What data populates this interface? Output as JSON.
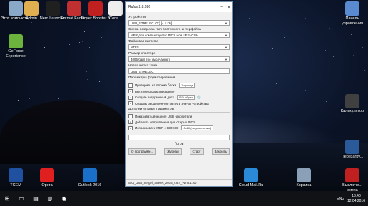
{
  "desktop": {
    "icons": [
      {
        "name": "desktop-icon-computer",
        "label": "Этот компьютер",
        "color": "#8aa9c8"
      },
      {
        "name": "desktop-icon-admin",
        "label": "Admin",
        "color": "#e0b050"
      },
      {
        "name": "desktop-icon-nero",
        "label": "Nero Launcher",
        "color": "#202020"
      },
      {
        "name": "desktop-icon-format-factory",
        "label": "Format Factory",
        "color": "#c03030"
      },
      {
        "name": "desktop-icon-driver-booster",
        "label": "Driver Booster 3",
        "color": "#c02020"
      },
      {
        "name": "desktop-icon-corel",
        "label": "Corel...",
        "color": "#eeeeee"
      },
      {
        "name": "desktop-icon-geforce",
        "label": "GeForce Experience",
        "color": "#6cb33e"
      },
      {
        "name": "desktop-icon-control-panel",
        "label": "Панель управления",
        "color": "#5a8ad0"
      },
      {
        "name": "desktop-icon-calculator",
        "label": "Калькулятор",
        "color": "#404040"
      },
      {
        "name": "desktop-icon-restart",
        "label": "Перезагру...",
        "color": "#2a5a9a"
      },
      {
        "name": "desktop-icon-tcem",
        "label": "TCEM",
        "color": "#2050a0"
      },
      {
        "name": "desktop-icon-opera",
        "label": "Opera",
        "color": "#e02020"
      },
      {
        "name": "desktop-icon-outlook",
        "label": "Outlook 2016",
        "color": "#1a70c8"
      },
      {
        "name": "desktop-icon-skype",
        "label": "Skype",
        "color": "#00a8e8"
      },
      {
        "name": "desktop-icon-cloud-mail",
        "label": "Cloud Mail.Ru",
        "color": "#2a8ad8"
      },
      {
        "name": "desktop-icon-recycle-bin",
        "label": "Корзина",
        "color": "#8aa0b8"
      },
      {
        "name": "desktop-icon-shutdown",
        "label": "Выключе... компа",
        "color": "#c02020"
      }
    ]
  },
  "rufus": {
    "title": "Rufus 2.8.886",
    "device_label": "Устройство",
    "device_value": "USB_STRELEC (G:) [4.1 ГБ]",
    "partition_label": "Схема раздела и тип системного интерфейса",
    "partition_value": "MBR для компьютеров с BIOS или UEFI-CSM",
    "fs_label": "Файловая система",
    "fs_value": "NTFS",
    "cluster_label": "Размер кластера",
    "cluster_value": "4096 байт (по умолчанию)",
    "volume_label": "Новая метка тома",
    "volume_value": "USB_STRELEC",
    "format_options_label": "Параметры форматирования",
    "opt_badblocks": "Проверить на плохие блоки",
    "opt_badblocks_pass": "1 проход",
    "opt_quick": "Быстрое форматирование",
    "opt_bootable": "Создать загрузочный диск",
    "opt_bootable_type": "ISO-образ",
    "opt_extended": "Создать расширенную метку и значок устройства",
    "advanced_label": "Дополнительные параметры",
    "opt_show_usb": "Показывать внешние USB накопители",
    "opt_old_bios": "Добавить исправления для старых BIOS",
    "opt_rufus_mbr": "Использовать MBR с BIOS ID",
    "opt_rufus_mbr_value": "0x80 (по умолчанию)",
    "status": "Готов",
    "btn_about": "О программе...",
    "btn_log": "Журнал",
    "btn_start": "Старт",
    "btn_close": "Закрыть",
    "footer": "Boot_USB_Sergei_Strelec_2015_v.8.4_Win8.1.iso"
  },
  "taskbar": {
    "lang": "ENG",
    "time": "13:40",
    "date": "12.04.2016"
  }
}
